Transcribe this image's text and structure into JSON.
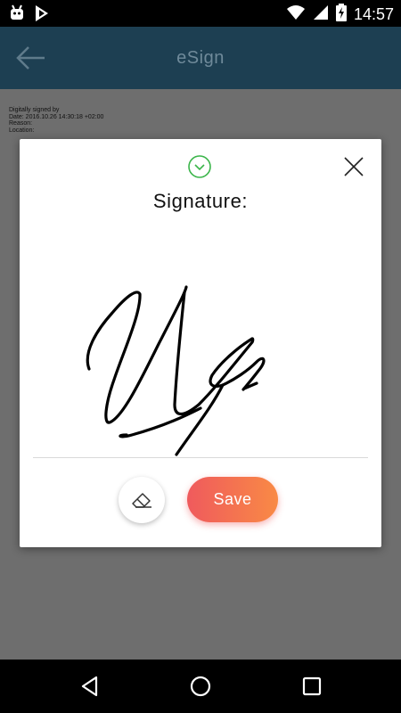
{
  "status_bar": {
    "time": "14:57",
    "icons": [
      "android-icon",
      "play-store-icon",
      "wifi-icon",
      "signal-icon",
      "battery-charging-icon"
    ]
  },
  "app_bar": {
    "title": "eSign",
    "back_icon": "arrow-left-icon"
  },
  "document": {
    "signature_info": [
      "Digitally signed by",
      "Date: 2016.10.26 14:30:18 +02:00",
      "Reason:",
      "Location:"
    ]
  },
  "dialog": {
    "title": "Signature:",
    "confirm_icon": "check-circle-icon",
    "close_icon": "close-icon",
    "clear_icon": "eraser-icon",
    "save_label": "Save",
    "colors": {
      "save_gradient_start": "#ef5a5d",
      "save_gradient_end": "#f98a45",
      "confirm_green": "#3bb54a"
    }
  },
  "nav_bar": {
    "icons": [
      "back-triangle-icon",
      "home-circle-icon",
      "recents-square-icon"
    ]
  }
}
